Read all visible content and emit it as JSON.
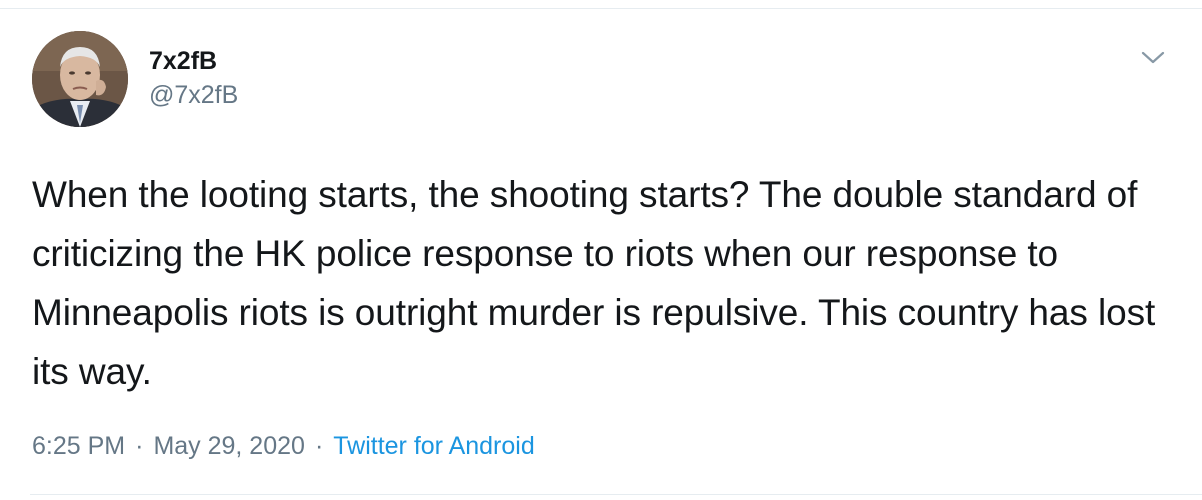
{
  "user": {
    "display_name": "7x2fB",
    "handle": "@7x2fB"
  },
  "tweet": {
    "text": "When the looting starts, the shooting starts? The double standard of criticizing the HK police response to riots when our response to Minneapolis riots is outright murder is repulsive. This country has lost its way.",
    "time": "6:25 PM",
    "date": "May 29, 2020",
    "source": "Twitter for Android",
    "separator": "·"
  },
  "icons": {
    "menu": "chevron-down-icon"
  },
  "colors": {
    "text": "#14171a",
    "secondary": "#657786",
    "link": "#1b95e0",
    "border": "#e6ecf0"
  }
}
